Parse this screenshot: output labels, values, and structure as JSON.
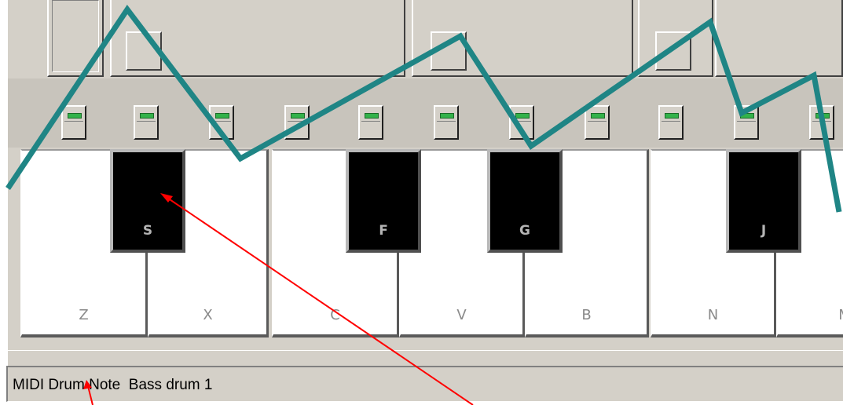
{
  "keyboard": {
    "white_keys": [
      "Z",
      "X",
      "C",
      "V",
      "B",
      "N",
      "M"
    ],
    "black_keys": [
      "S",
      "F",
      "G",
      "J"
    ]
  },
  "status_bar": {
    "text": "MIDI Drum Note  Bass drum 1"
  },
  "colors": {
    "overlay_line": "#1f8585",
    "annotation_arrow": "#ff0000",
    "led": "#33b24a"
  }
}
